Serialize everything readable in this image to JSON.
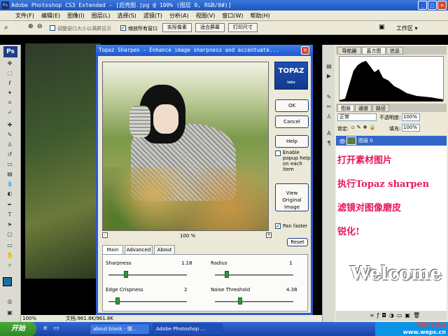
{
  "app": {
    "title": "Adobe Photoshop CS3 Extended - [后壳图.jpg @ 100% (图层 0, RGB/8#)]",
    "ps_badge": "Ps",
    "window_buttons": [
      "_",
      "□",
      "×"
    ]
  },
  "menu": [
    "文件(F)",
    "编辑(E)",
    "图像(I)",
    "图层(L)",
    "选择(S)",
    "滤镜(T)",
    "分析(A)",
    "视图(V)",
    "窗口(W)",
    "帮助(H)"
  ],
  "options": {
    "resize_window_label": "调整窗口大小以满屏显示",
    "zoom_all_label": "缩放所有窗口",
    "actual_pixels": "实际像素",
    "fit_screen": "适合屏幕",
    "print_size": "打印尺寸",
    "workspace": "工作区 ▾"
  },
  "dialog": {
    "title": "Topaz Sharpen - Enhance image sharpness and accentuate...",
    "logo_text": "TOPAZ",
    "logo_sub": "labs",
    "ok": "OK",
    "cancel": "Cancel",
    "help": "Help",
    "popup_help": "Enable popup help on each item",
    "view_original": "View Original Image",
    "pan_faster": "Pan faster",
    "reset": "Reset",
    "zoom": "100 %",
    "tabs": [
      "Main",
      "Advanced",
      "About"
    ],
    "params": {
      "sharpness": {
        "label": "Sharpness",
        "value": "1.18",
        "level": 0.22
      },
      "radius": {
        "label": "Radius",
        "value": "1",
        "level": 0.15
      },
      "edge_crispness": {
        "label": "Edge Crispness",
        "value": "2",
        "level": 0.12
      },
      "noise_threshold": {
        "label": "Noise Threshold",
        "value": "4.38",
        "level": 0.32
      }
    }
  },
  "panels": {
    "top_tabs": [
      "导航器",
      "直方图",
      "信息"
    ],
    "layer_tabs": [
      "图层",
      "通道",
      "路径"
    ],
    "blend_mode": "正常",
    "opacity_label": "不透明度:",
    "opacity_value": "100%",
    "lock_label": "锁定:",
    "fill_label": "填充:",
    "fill_value": "100%",
    "layer_name": "图层 0"
  },
  "annotation": {
    "line1": "打开素材图片",
    "line2": "执行Topaz sharpen",
    "line3": "滤镜对图像磨皮",
    "line4": "锐化!",
    "welcome": "Welcome"
  },
  "status": {
    "zoom": "100%",
    "doc": "文档:961.8K/961.8K"
  },
  "taskbar": {
    "start": "开始",
    "tasks": [
      "about:blank - 微...",
      "Adobe Photoshop ..."
    ],
    "tray_line1": "飞特PS论坛",
    "tray_line2": "www.weps.cn"
  },
  "colors": {
    "annotation": "#e6195b",
    "accent": "#2a5bd7",
    "slider_thumb": "#2c9a3c"
  }
}
